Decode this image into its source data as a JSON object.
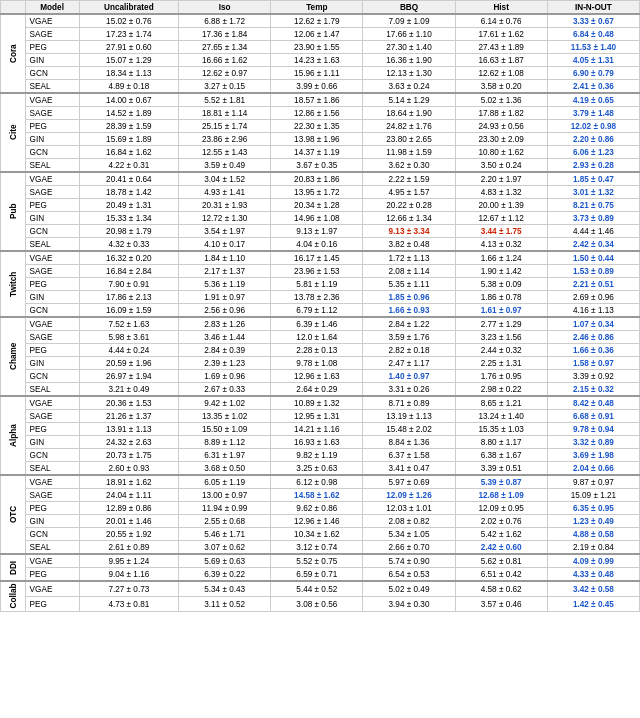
{
  "headers": [
    "Model",
    "Uncalibrated",
    "Iso",
    "Temp",
    "BBQ",
    "Hist",
    "IN-N-OUT"
  ],
  "groups": [
    {
      "label": "Cora",
      "rows": [
        {
          "model": "VGAE",
          "vals": [
            "15.02 ± 0.76",
            "6.88 ± 1.72",
            "12.62 ± 1.79",
            "7.09 ± 1.09",
            "6.14 ± 0.76",
            "3.33 ± 0.67"
          ],
          "bold": [
            5
          ],
          "color": [
            "blue"
          ]
        },
        {
          "model": "SAGE",
          "vals": [
            "17.23 ± 1.74",
            "17.36 ± 1.84",
            "12.06 ± 1.47",
            "17.66 ± 1.10",
            "17.61 ± 1.62",
            "6.84 ± 0.48"
          ],
          "bold": [
            5
          ],
          "color": [
            "blue"
          ]
        },
        {
          "model": "PEG",
          "vals": [
            "27.91 ± 0.60",
            "27.65 ± 1.34",
            "23.90 ± 1.55",
            "27.30 ± 1.40",
            "27.43 ± 1.89",
            "11.53 ± 1.40"
          ],
          "bold": [
            5
          ],
          "color": [
            "blue"
          ]
        },
        {
          "model": "GIN",
          "vals": [
            "15.07 ± 1.29",
            "16.66 ± 1.62",
            "14.23 ± 1.63",
            "16.36 ± 1.90",
            "16.63 ± 1.87",
            "4.05 ± 1.31"
          ],
          "bold": [
            5
          ],
          "color": [
            "blue"
          ]
        },
        {
          "model": "GCN",
          "vals": [
            "18.34 ± 1.13",
            "12.62 ± 0.97",
            "15.96 ± 1.11",
            "12.13 ± 1.30",
            "12.62 ± 1.08",
            "6.90 ± 0.79"
          ],
          "bold": [
            5
          ],
          "color": [
            "blue"
          ]
        },
        {
          "model": "SEAL",
          "vals": [
            "4.89 ± 0.18",
            "3.27 ± 0.15",
            "3.99 ± 0.66",
            "3.63 ± 0.24",
            "3.58 ± 0.20",
            "2.41 ± 0.36"
          ],
          "bold": [
            5
          ],
          "color": [
            "blue"
          ]
        }
      ]
    },
    {
      "label": "Cite",
      "rows": [
        {
          "model": "VGAE",
          "vals": [
            "14.00 ± 0.67",
            "5.52 ± 1.81",
            "18.57 ± 1.86",
            "5.14 ± 1.29",
            "5.02 ± 1.36",
            "4.19 ± 0.65"
          ],
          "bold": [
            5
          ],
          "color": [
            "blue"
          ]
        },
        {
          "model": "SAGE",
          "vals": [
            "14.52 ± 1.89",
            "18.81 ± 1.14",
            "12.86 ± 1.56",
            "18.64 ± 1.90",
            "17.88 ± 1.82",
            "3.79 ± 1.48"
          ],
          "bold": [
            5
          ],
          "color": [
            "blue"
          ]
        },
        {
          "model": "PEG",
          "vals": [
            "28.39 ± 1.59",
            "25.15 ± 1.74",
            "22.30 ± 1.35",
            "24.82 ± 1.76",
            "24.93 ± 0.56",
            "12.02 ± 0.98"
          ],
          "bold": [
            5
          ],
          "color": [
            "blue"
          ]
        },
        {
          "model": "GIN",
          "vals": [
            "15.69 ± 1.89",
            "23.86 ± 2.96",
            "13.98 ± 1.96",
            "23.80 ± 2.65",
            "23.30 ± 2.09",
            "2.20 ± 0.86"
          ],
          "bold": [
            5
          ],
          "color": [
            "blue"
          ]
        },
        {
          "model": "GCN",
          "vals": [
            "16.84 ± 1.62",
            "12.55 ± 1.43",
            "14.37 ± 1.19",
            "11.98 ± 1.59",
            "10.80 ± 1.62",
            "6.06 ± 1.23"
          ],
          "bold": [
            5
          ],
          "color": [
            "blue"
          ]
        },
        {
          "model": "SEAL",
          "vals": [
            "4.22 ± 0.31",
            "3.59 ± 0.49",
            "3.67 ± 0.35",
            "3.62 ± 0.30",
            "3.50 ± 0.24",
            "2.93 ± 0.28"
          ],
          "bold": [
            5
          ],
          "color": [
            "blue"
          ]
        }
      ]
    },
    {
      "label": "Pub",
      "rows": [
        {
          "model": "VGAE",
          "vals": [
            "20.41 ± 0.64",
            "3.04 ± 1.52",
            "20.83 ± 1.86",
            "2.22 ± 1.59",
            "2.20 ± 1.97",
            "1.85 ± 0.47"
          ],
          "bold": [
            5
          ],
          "color": [
            "blue"
          ]
        },
        {
          "model": "SAGE",
          "vals": [
            "18.78 ± 1.42",
            "4.93 ± 1.41",
            "13.95 ± 1.72",
            "4.95 ± 1.57",
            "4.83 ± 1.32",
            "3.01 ± 1.32"
          ],
          "bold": [
            5
          ],
          "color": [
            "blue"
          ]
        },
        {
          "model": "PEG",
          "vals": [
            "20.49 ± 1.31",
            "20.31 ± 1.93",
            "20.34 ± 1.28",
            "20.22 ± 0.28",
            "20.00 ± 1.39",
            "8.21 ± 0.75"
          ],
          "bold": [
            5
          ],
          "color": [
            "blue"
          ]
        },
        {
          "model": "GIN",
          "vals": [
            "15.33 ± 1.34",
            "12.72 ± 1.30",
            "14.96 ± 1.08",
            "12.66 ± 1.34",
            "12.67 ± 1.12",
            "3.73 ± 0.89"
          ],
          "bold": [
            5
          ],
          "color": [
            "blue"
          ]
        },
        {
          "model": "GCN",
          "vals": [
            "20.98 ± 1.79",
            "3.54 ± 1.97",
            "9.13 ± 1.97",
            "9.13 ± 3.34",
            "3.44 ± 1.75",
            "4.44 ± 1.46"
          ],
          "bold": [
            4
          ],
          "color": [
            "red"
          ]
        },
        {
          "model": "SEAL",
          "vals": [
            "4.32 ± 0.33",
            "4.10 ± 0.17",
            "4.04 ± 0.16",
            "3.82 ± 0.48",
            "4.13 ± 0.32",
            "2.42 ± 0.34"
          ],
          "bold": [
            5
          ],
          "color": [
            "blue"
          ]
        }
      ]
    },
    {
      "label": "Twitch",
      "rows": [
        {
          "model": "VGAE",
          "vals": [
            "16.32 ± 0.20",
            "1.84 ± 1.10",
            "16.17 ± 1.45",
            "1.72 ± 1.13",
            "1.66 ± 1.24",
            "1.50 ± 0.44"
          ],
          "bold": [
            5
          ],
          "color": [
            "blue"
          ]
        },
        {
          "model": "SAGE",
          "vals": [
            "16.84 ± 2.84",
            "2.17 ± 1.37",
            "23.96 ± 1.53",
            "2.08 ± 1.14",
            "1.90 ± 1.42",
            "1.53 ± 0.89"
          ],
          "bold": [
            5
          ],
          "color": [
            "blue"
          ]
        },
        {
          "model": "PEG",
          "vals": [
            "7.90 ± 0.91",
            "5.36 ± 1.19",
            "5.81 ± 1.19",
            "5.35 ± 1.11",
            "5.38 ± 0.09",
            "2.21 ± 0.51"
          ],
          "bold": [
            5
          ],
          "color": [
            "blue"
          ]
        },
        {
          "model": "GIN",
          "vals": [
            "17.86 ± 2.13",
            "1.91 ± 0.97",
            "13.78 ± 2.36",
            "1.85 ± 0.96",
            "1.86 ± 0.78",
            "2.69 ± 0.96"
          ],
          "bold": [
            3
          ],
          "color": [
            "blue"
          ]
        },
        {
          "model": "GCN",
          "vals": [
            "16.09 ± 1.59",
            "2.56 ± 0.96",
            "6.79 ± 1.12",
            "1.66 ± 0.93",
            "1.61 ± 0.97",
            "4.16 ± 1.13"
          ],
          "bold": [
            4
          ],
          "color": [
            "blue"
          ]
        }
      ]
    },
    {
      "label": "Chame",
      "rows": [
        {
          "model": "VGAE",
          "vals": [
            "7.52 ± 1.63",
            "2.83 ± 1.26",
            "6.39 ± 1.46",
            "2.84 ± 1.22",
            "2.77 ± 1.29",
            "1.07 ± 0.34"
          ],
          "bold": [
            5
          ],
          "color": [
            "blue"
          ]
        },
        {
          "model": "SAGE",
          "vals": [
            "5.98 ± 3.61",
            "3.46 ± 1.44",
            "12.0 ± 1.64",
            "3.59 ± 1.76",
            "3.23 ± 1.56",
            "2.46 ± 0.86"
          ],
          "bold": [
            5
          ],
          "color": [
            "blue"
          ]
        },
        {
          "model": "PEG",
          "vals": [
            "4.44 ± 0.24",
            "2.84 ± 0.39",
            "2.28 ± 0.13",
            "2.82 ± 0.18",
            "2.44 ± 0.32",
            "1.66 ± 0.36"
          ],
          "bold": [
            5
          ],
          "color": [
            "blue"
          ]
        },
        {
          "model": "GIN",
          "vals": [
            "20.59 ± 1.96",
            "2.39 ± 1.23",
            "9.78 ± 1.08",
            "2.47 ± 1.17",
            "2.25 ± 1.31",
            "1.58 ± 0.97"
          ],
          "bold": [
            5
          ],
          "color": [
            "blue"
          ]
        },
        {
          "model": "GCN",
          "vals": [
            "26.97 ± 1.94",
            "1.69 ± 0.96",
            "12.96 ± 1.63",
            "1.40 ± 0.97",
            "1.76 ± 0.95",
            "3.39 ± 0.92"
          ],
          "bold": [
            3
          ],
          "color": [
            "blue"
          ]
        },
        {
          "model": "SEAL",
          "vals": [
            "3.21 ± 0.49",
            "2.67 ± 0.33",
            "2.64 ± 0.29",
            "3.31 ± 0.26",
            "2.98 ± 0.22",
            "2.15 ± 0.32"
          ],
          "bold": [
            5
          ],
          "color": [
            "blue"
          ]
        }
      ]
    },
    {
      "label": "Alpha",
      "rows": [
        {
          "model": "VGAE",
          "vals": [
            "20.36 ± 1.53",
            "9.42 ± 1.02",
            "10.89 ± 1.32",
            "8.71 ± 0.89",
            "8.65 ± 1.21",
            "8.42 ± 0.48"
          ],
          "bold": [
            5
          ],
          "color": [
            "blue"
          ]
        },
        {
          "model": "SAGE",
          "vals": [
            "21.26 ± 1.37",
            "13.35 ± 1.02",
            "12.95 ± 1.31",
            "13.19 ± 1.13",
            "13.24 ± 1.40",
            "6.68 ± 0.91"
          ],
          "bold": [
            5
          ],
          "color": [
            "blue"
          ]
        },
        {
          "model": "PEG",
          "vals": [
            "13.91 ± 1.13",
            "15.50 ± 1.09",
            "14.21 ± 1.16",
            "15.48 ± 2.02",
            "15.35 ± 1.03",
            "9.78 ± 0.94"
          ],
          "bold": [
            5
          ],
          "color": [
            "blue"
          ]
        },
        {
          "model": "GIN",
          "vals": [
            "24.32 ± 2.63",
            "8.89 ± 1.12",
            "16.93 ± 1.63",
            "8.84 ± 1.36",
            "8.80 ± 1.17",
            "3.32 ± 0.89"
          ],
          "bold": [
            5
          ],
          "color": [
            "blue"
          ]
        },
        {
          "model": "GCN",
          "vals": [
            "20.73 ± 1.75",
            "6.31 ± 1.97",
            "9.82 ± 1.19",
            "6.37 ± 1.58",
            "6.38 ± 1.67",
            "3.69 ± 1.98"
          ],
          "bold": [
            5
          ],
          "color": [
            "blue"
          ]
        },
        {
          "model": "SEAL",
          "vals": [
            "2.60 ± 0.93",
            "3.68 ± 0.50",
            "3.25 ± 0.63",
            "3.41 ± 0.47",
            "3.39 ± 0.51",
            "2.04 ± 0.66"
          ],
          "bold": [
            5
          ],
          "color": [
            "blue"
          ]
        }
      ]
    },
    {
      "label": "OTC",
      "rows": [
        {
          "model": "VGAE",
          "vals": [
            "18.91 ± 1.62",
            "6.05 ± 1.19",
            "6.12 ± 0.98",
            "5.97 ± 0.69",
            "5.39 ± 0.87",
            "9.87 ± 0.97"
          ],
          "bold": [
            4
          ],
          "color": [
            "blue"
          ]
        },
        {
          "model": "SAGE",
          "vals": [
            "24.04 ± 1.11",
            "13.00 ± 0.97",
            "14.58 ± 1.62",
            "12.09 ± 1.26",
            "12.68 ± 1.09",
            "15.09 ± 1.21"
          ],
          "bold": [
            3
          ],
          "color": [
            "blue"
          ]
        },
        {
          "model": "PEG",
          "vals": [
            "12.89 ± 0.86",
            "11.94 ± 0.99",
            "9.62 ± 0.86",
            "12.03 ± 1.01",
            "12.09 ± 0.95",
            "6.35 ± 0.95"
          ],
          "bold": [
            5
          ],
          "color": [
            "blue"
          ]
        },
        {
          "model": "GIN",
          "vals": [
            "20.01 ± 1.46",
            "2.55 ± 0.68",
            "12.96 ± 1.46",
            "2.08 ± 0.82",
            "2.02 ± 0.76",
            "1.23 ± 0.49"
          ],
          "bold": [
            5
          ],
          "color": [
            "blue"
          ]
        },
        {
          "model": "GCN",
          "vals": [
            "20.55 ± 1.92",
            "5.46 ± 1.71",
            "10.34 ± 1.62",
            "5.34 ± 1.05",
            "5.42 ± 1.62",
            "4.88 ± 0.58"
          ],
          "bold": [
            5
          ],
          "color": [
            "blue"
          ]
        },
        {
          "model": "SEAL",
          "vals": [
            "2.61 ± 0.89",
            "3.07 ± 0.62",
            "3.12 ± 0.74",
            "2.66 ± 0.70",
            "2.42 ± 0.60",
            "2.19 ± 0.84"
          ],
          "bold": [
            4
          ],
          "color": [
            "blue"
          ]
        }
      ]
    },
    {
      "label": "DDI",
      "rows": [
        {
          "model": "VGAE",
          "vals": [
            "9.95 ± 1.24",
            "5.69 ± 0.63",
            "5.52 ± 0.75",
            "5.74 ± 0.90",
            "5.62 ± 0.81",
            "4.09 ± 0.99"
          ],
          "bold": [
            5
          ],
          "color": [
            "blue"
          ]
        },
        {
          "model": "PEG",
          "vals": [
            "9.04 ± 1.16",
            "6.39 ± 0.22",
            "6.59 ± 0.71",
            "6.54 ± 0.53",
            "6.51 ± 0.42",
            "4.33 ± 0.48"
          ],
          "bold": [
            5
          ],
          "color": [
            "blue"
          ]
        }
      ]
    },
    {
      "label": "Collab",
      "rows": [
        {
          "model": "VGAE",
          "vals": [
            "7.27 ± 0.73",
            "5.34 ± 0.43",
            "5.44 ± 0.52",
            "5.02 ± 0.49",
            "4.58 ± 0.62",
            "3.42 ± 0.58"
          ],
          "bold": [
            5
          ],
          "color": [
            "blue"
          ]
        },
        {
          "model": "PEG",
          "vals": [
            "4.73 ± 0.81",
            "3.11 ± 0.52",
            "3.08 ± 0.56",
            "3.94 ± 0.30",
            "3.57 ± 0.46",
            "1.42 ± 0.45"
          ],
          "bold": [
            5
          ],
          "color": [
            "blue"
          ]
        }
      ]
    }
  ]
}
